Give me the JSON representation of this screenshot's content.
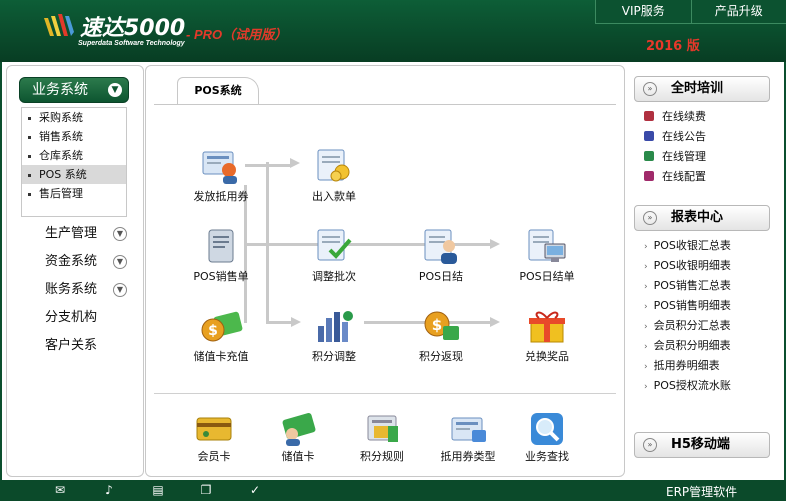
{
  "header": {
    "title": "速达5000",
    "subtitle": "Superdata Software Technology",
    "edition": "- PRO（试用版）",
    "year": "2016 版",
    "links": [
      "VIP服务",
      "产品升级"
    ]
  },
  "sidebar": {
    "head": "业务系统",
    "sub_items": [
      "采购系统",
      "销售系统",
      "仓库系统",
      "POS 系统",
      "售后管理"
    ],
    "active_index": 3,
    "items": [
      "生产管理",
      "资金系统",
      "账务系统",
      "分支机构",
      "客户关系"
    ]
  },
  "main": {
    "tab": "POS系统",
    "flow": {
      "issue_voucher": "发放抵用券",
      "in_out_bill": "出入款单",
      "pos_sale": "POS销售单",
      "adjust_batch": "调整批次",
      "pos_daily": "POS日结",
      "pos_daily_bill": "POS日结单",
      "card_recharge": "储值卡充值",
      "points_adjust": "积分调整",
      "points_return": "积分返现",
      "redeem_prize": "兑换奖品"
    },
    "tools": [
      "会员卡",
      "储值卡",
      "积分规则",
      "抵用券类型",
      "业务查找"
    ]
  },
  "right": {
    "training_head": "全时培训",
    "training_links": [
      "在线续费",
      "在线公告",
      "在线管理",
      "在线配置"
    ],
    "report_head": "报表中心",
    "report_links": [
      "POS收银汇总表",
      "POS收银明细表",
      "POS销售汇总表",
      "POS销售明细表",
      "会员积分汇总表",
      "会员积分明细表",
      "抵用券明细表",
      "POS授权流水账"
    ],
    "mobile_head": "H5移动端"
  },
  "footer": {
    "brand": "ERP管理软件",
    "icons": [
      "mail-icon",
      "speaker-icon",
      "book-icon",
      "copy-icon",
      "check-icon"
    ]
  },
  "colors": {
    "brand_green": "#0d5e37",
    "accent_red": "#e23a2a"
  }
}
